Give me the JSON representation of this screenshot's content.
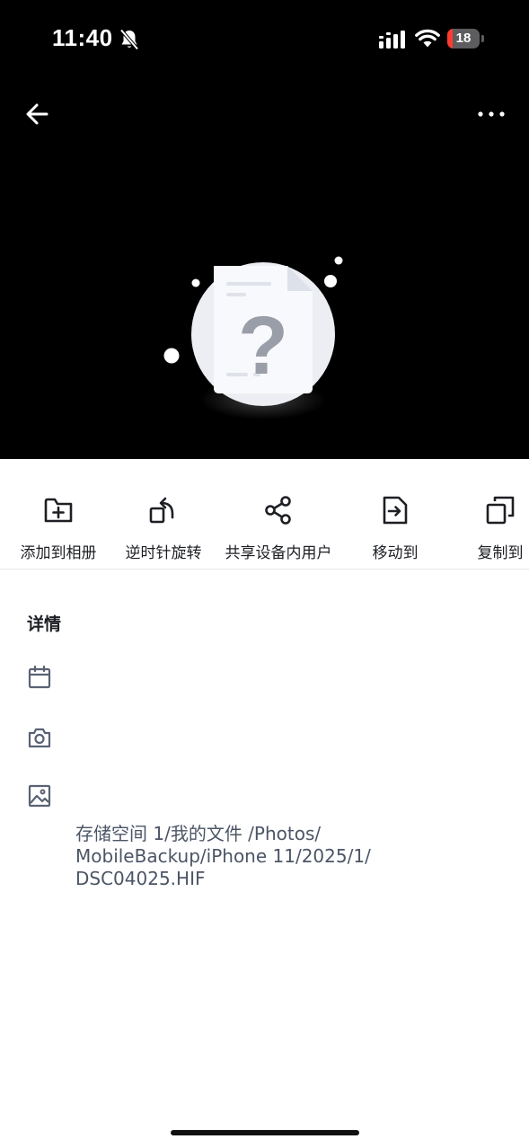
{
  "status_bar": {
    "time": "11:40",
    "battery": "18",
    "battery_level": 0.18
  },
  "header": {
    "back_icon": "arrow-left-icon",
    "more_icon": "more-horizontal-icon"
  },
  "preview": {
    "icon": "unknown-file-icon",
    "glyph": "?"
  },
  "actions": [
    {
      "label": "添加到相册",
      "icon": "add-to-album-icon"
    },
    {
      "label": "逆时针旋转",
      "icon": "rotate-counterclockwise-icon"
    },
    {
      "label": "共享设备内用户",
      "icon": "share-icon"
    },
    {
      "label": "移动到",
      "icon": "move-to-icon"
    },
    {
      "label": "复制到",
      "icon": "copy-icon"
    }
  ],
  "details": {
    "title": "详情",
    "rows": [
      {
        "icon": "calendar-icon"
      },
      {
        "icon": "camera-icon"
      },
      {
        "icon": "image-icon"
      }
    ],
    "path_line1": "存储空间 1/我的文件 /Photos/",
    "path_line2": "MobileBackup/iPhone 11/2025/1/",
    "path_line3": "DSC04025.HIF"
  },
  "colors": {
    "top_background": "#000000",
    "text_primary": "#1d1f24",
    "text_secondary": "#4c5566",
    "battery_low": "#ff3b30"
  }
}
